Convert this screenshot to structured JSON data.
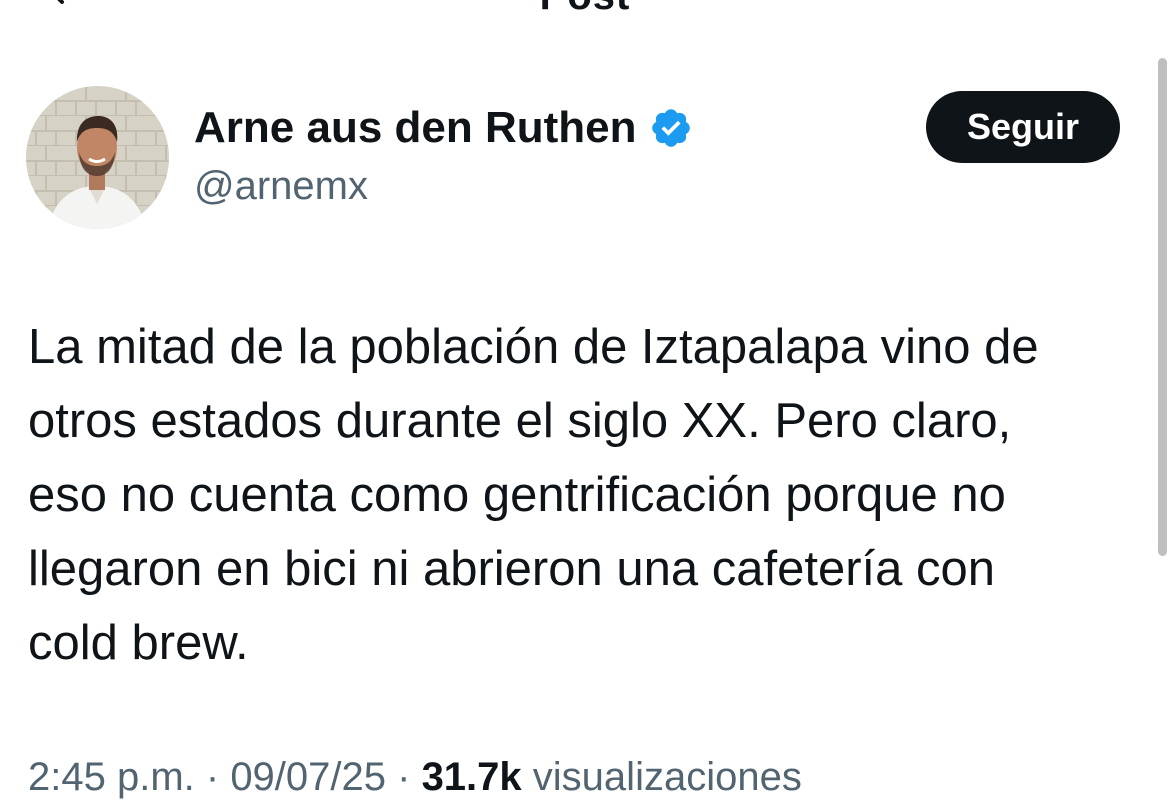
{
  "header": {
    "title": "Post"
  },
  "author": {
    "display_name": "Arne aus den Ruthen",
    "handle": "@arnemx",
    "verified": true,
    "verified_color": "#1d9bf0"
  },
  "follow_button": {
    "label": "Seguir"
  },
  "tweet": {
    "lines": [
      "La mitad de la población de Iztapalapa vino de",
      "otros estados durante el siglo XX. Pero claro,",
      "eso no cuenta como gentrificación porque no",
      "llegaron en bici ni abrieron una cafetería con",
      "cold brew."
    ]
  },
  "meta": {
    "time": "2:45 p.m.",
    "separator": " · ",
    "date": "09/07/25",
    "views_count": "31.7k",
    "views_label": "visualizaciones"
  },
  "icons": {
    "back": "arrow-left-icon",
    "verified": "verified-badge-icon"
  },
  "colors": {
    "text_primary": "#0f1419",
    "text_secondary": "#536471",
    "button_bg": "#0f1419",
    "verified": "#1d9bf0"
  }
}
